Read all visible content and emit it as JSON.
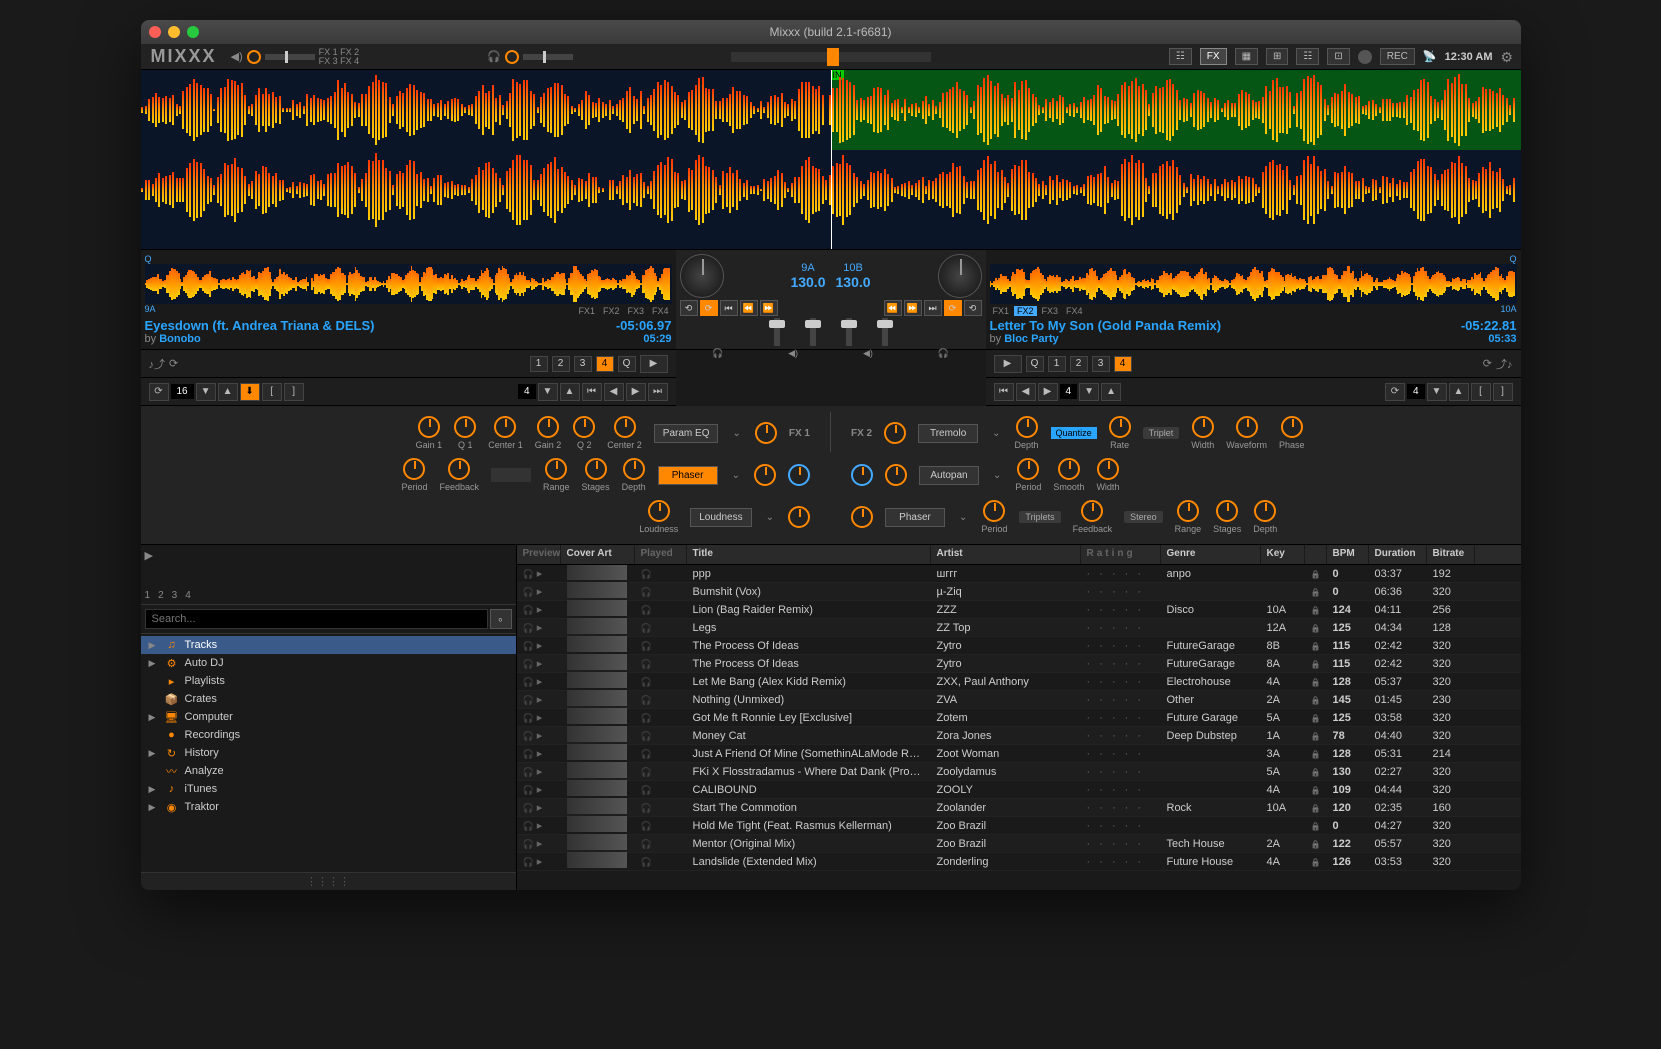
{
  "window": {
    "title": "Mixxx (build 2.1-r6681)"
  },
  "logo": "MIXXX",
  "topbar": {
    "fx_labels": [
      "FX 1",
      "FX 2",
      "FX 3",
      "FX 4"
    ],
    "buttons": {
      "fx": "FX",
      "rec": "REC"
    },
    "clock": "12:30 AM"
  },
  "deck1": {
    "q_label": "9A",
    "fx_assign": [
      "FX1",
      "FX2",
      "FX3",
      "FX4"
    ],
    "title": "Eyesdown (ft. Andrea Triana & DELS)",
    "artist_prefix": "by ",
    "artist": "Bonobo",
    "time_remaining": "-05:06.97",
    "duration": "05:29",
    "key": "9A",
    "bpm": "130.0",
    "hotcues": [
      "1",
      "2",
      "3",
      "4"
    ],
    "q_button": "Q",
    "loop_size": "16",
    "beatjump": "4"
  },
  "deck2": {
    "q_label": "10A",
    "fx_assign": [
      "FX1",
      "FX2",
      "FX3",
      "FX4"
    ],
    "title": "Letter To My Son (Gold Panda Remix)",
    "artist_prefix": "by ",
    "artist": "Bloc Party",
    "time_remaining": "-05:22.81",
    "duration": "05:33",
    "key": "10B",
    "bpm": "130.0",
    "hotcues": [
      "1",
      "2",
      "3",
      "4"
    ],
    "q_button": "Q",
    "loop_size": "4",
    "beatjump": "4"
  },
  "fx1": {
    "header": "FX 1",
    "units": [
      {
        "name": "Param EQ",
        "knobs": [
          "Gain 1",
          "Q 1",
          "Center 1",
          "Gain 2",
          "Q 2",
          "Center 2"
        ]
      },
      {
        "name": "Phaser",
        "highlighted": true,
        "knobs": [
          "Period",
          "Feedback",
          "Range",
          "Stages",
          "Depth"
        ],
        "left_knobs": [
          "Period",
          "Feedback"
        ]
      },
      {
        "name": "Loudness",
        "knobs": [
          "Loudness"
        ]
      }
    ]
  },
  "fx2": {
    "header": "FX 2",
    "units": [
      {
        "name": "Tremolo",
        "knobs": [
          "Depth",
          "Rate",
          "Width",
          "Waveform",
          "Phase"
        ],
        "badge": "Quantize",
        "tag": "Triplet"
      },
      {
        "name": "Autopan",
        "knobs": [
          "Period",
          "Smooth",
          "Width"
        ]
      },
      {
        "name": "Phaser",
        "knobs": [
          "Period",
          "Feedback",
          "Range",
          "Stages",
          "Depth"
        ],
        "tag1": "Triplets",
        "tag2": "Stereo"
      }
    ]
  },
  "search": {
    "placeholder": "Search..."
  },
  "tree": [
    {
      "icon": "♫",
      "label": "Tracks",
      "arrow": "▶",
      "selected": true
    },
    {
      "icon": "⚙",
      "label": "Auto DJ",
      "arrow": "▶"
    },
    {
      "icon": "▸",
      "label": "Playlists",
      "arrow": ""
    },
    {
      "icon": "📦",
      "label": "Crates",
      "arrow": ""
    },
    {
      "icon": "🖥",
      "label": "Computer",
      "arrow": "▶"
    },
    {
      "icon": "●",
      "label": "Recordings",
      "arrow": ""
    },
    {
      "icon": "↻",
      "label": "History",
      "arrow": "▶"
    },
    {
      "icon": "〰",
      "label": "Analyze",
      "arrow": ""
    },
    {
      "icon": "♪",
      "label": "iTunes",
      "arrow": "▶"
    },
    {
      "icon": "◉",
      "label": "Traktor",
      "arrow": "▶"
    }
  ],
  "preview_nums": [
    "1",
    "2",
    "3",
    "4"
  ],
  "library": {
    "columns": [
      "Preview",
      "Cover Art",
      "Played",
      "Title",
      "Artist",
      "Rating",
      "Genre",
      "Key",
      "BPM",
      "Duration",
      "Bitrate"
    ],
    "rows": [
      {
        "title": "ppp",
        "artist": "шггг",
        "genre": "anpo",
        "key": "",
        "bpm": "0",
        "duration": "03:37",
        "bitrate": "192"
      },
      {
        "title": "Bumshit (Vox)",
        "artist": "µ-Ziq",
        "genre": "",
        "key": "",
        "bpm": "0",
        "duration": "06:36",
        "bitrate": "320"
      },
      {
        "title": "Lion (Bag Raider Remix)",
        "artist": "ZZZ",
        "genre": "Disco",
        "key": "10A",
        "bpm": "124",
        "duration": "04:11",
        "bitrate": "256"
      },
      {
        "title": "Legs",
        "artist": "ZZ Top",
        "genre": "",
        "key": "12A",
        "bpm": "125",
        "duration": "04:34",
        "bitrate": "128"
      },
      {
        "title": "The Process Of Ideas",
        "artist": "Zytro",
        "genre": "FutureGarage",
        "key": "8B",
        "bpm": "115",
        "duration": "02:42",
        "bitrate": "320"
      },
      {
        "title": "The Process Of Ideas",
        "artist": "Zytro",
        "genre": "FutureGarage",
        "key": "8A",
        "bpm": "115",
        "duration": "02:42",
        "bitrate": "320"
      },
      {
        "title": "Let Me Bang (Alex Kidd Remix)",
        "artist": "ZXX, Paul Anthony",
        "genre": "Electrohouse",
        "key": "4A",
        "bpm": "128",
        "duration": "05:37",
        "bitrate": "320"
      },
      {
        "title": "Nothing (Unmixed)",
        "artist": "ZVA",
        "genre": "Other",
        "key": "2A",
        "bpm": "145",
        "duration": "01:45",
        "bitrate": "230"
      },
      {
        "title": "Got Me ft Ronnie Ley [Exclusive]",
        "artist": "Zotem",
        "genre": "Future Garage",
        "key": "5A",
        "bpm": "125",
        "duration": "03:58",
        "bitrate": "320"
      },
      {
        "title": "Money Cat",
        "artist": "Zora Jones",
        "genre": "Deep Dubstep",
        "key": "1A",
        "bpm": "78",
        "duration": "04:40",
        "bitrate": "320"
      },
      {
        "title": "Just A Friend Of Mine (SomethinALaMode Remix)",
        "artist": "Zoot Woman",
        "genre": "",
        "key": "3A",
        "bpm": "128",
        "duration": "05:31",
        "bitrate": "214"
      },
      {
        "title": "FKi X Flosstradamus - Where Dat Dank (Prod B...",
        "artist": "Zoolydamus",
        "genre": "",
        "key": "5A",
        "bpm": "130",
        "duration": "02:27",
        "bitrate": "320"
      },
      {
        "title": "CALIBOUND",
        "artist": "ZOOLY",
        "genre": "",
        "key": "4A",
        "bpm": "109",
        "duration": "04:44",
        "bitrate": "320"
      },
      {
        "title": "Start The Commotion",
        "artist": "Zoolander",
        "genre": "Rock",
        "key": "10A",
        "bpm": "120",
        "duration": "02:35",
        "bitrate": "160"
      },
      {
        "title": "Hold Me Tight (Feat. Rasmus Kellerman)",
        "artist": "Zoo Brazil",
        "genre": "",
        "key": "",
        "bpm": "0",
        "duration": "04:27",
        "bitrate": "320"
      },
      {
        "title": "Mentor (Original Mix)",
        "artist": "Zoo Brazil",
        "genre": "Tech House",
        "key": "2A",
        "bpm": "122",
        "duration": "05:57",
        "bitrate": "320"
      },
      {
        "title": "Landslide (Extended Mix)",
        "artist": "Zonderling",
        "genre": "Future House",
        "key": "4A",
        "bpm": "126",
        "duration": "03:53",
        "bitrate": "320"
      }
    ]
  }
}
